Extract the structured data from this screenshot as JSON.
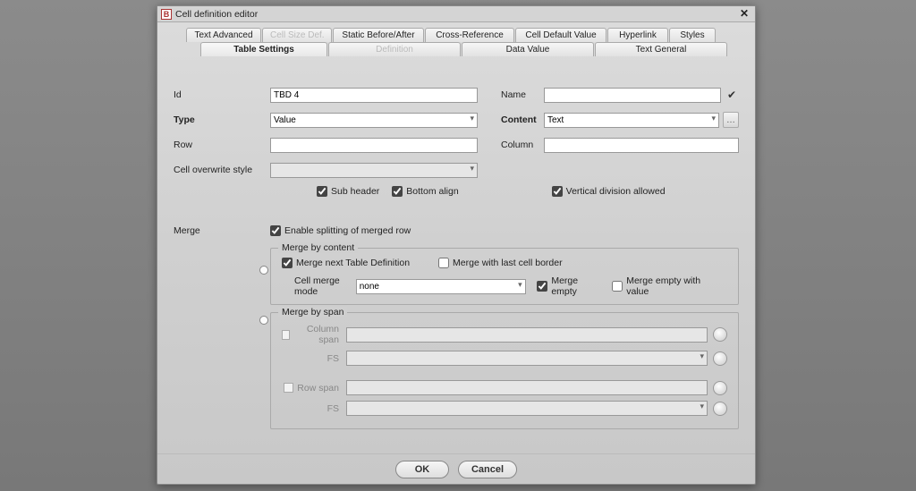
{
  "window": {
    "title": "Cell definition editor",
    "app_icon_letter": "B"
  },
  "tabs_row1": [
    {
      "label": "Text Advanced",
      "state": "normal"
    },
    {
      "label": "Cell Size Def.",
      "state": "disabled"
    },
    {
      "label": "Static Before/After",
      "state": "normal"
    },
    {
      "label": "Cross-Reference",
      "state": "normal"
    },
    {
      "label": "Cell Default Value",
      "state": "normal"
    },
    {
      "label": "Hyperlink",
      "state": "normal"
    },
    {
      "label": "Styles",
      "state": "normal"
    }
  ],
  "tabs_row2": [
    {
      "label": "Table Settings",
      "state": "active"
    },
    {
      "label": "Definition",
      "state": "disabled"
    },
    {
      "label": "Data Value",
      "state": "normal"
    },
    {
      "label": "Text General",
      "state": "normal"
    }
  ],
  "form": {
    "id_label": "Id",
    "id_value": "TBD 4",
    "name_label": "Name",
    "name_value": "",
    "type_label": "Type",
    "type_value": "Value",
    "content_label": "Content",
    "content_value": "Text",
    "row_label": "Row",
    "row_value": "",
    "column_label": "Column",
    "column_value": "",
    "overwrite_label": "Cell overwrite style",
    "overwrite_value": "",
    "subheader_label": "Sub header",
    "bottom_align_label": "Bottom align",
    "vertical_div_label": "Vertical division allowed"
  },
  "merge": {
    "section_label": "Merge",
    "enable_split_label": "Enable splitting of merged row",
    "by_content_legend": "Merge by content",
    "merge_next_label": "Merge next Table Definition",
    "merge_last_border_label": "Merge with last cell border",
    "cell_merge_mode_label": "Cell merge mode",
    "cell_merge_mode_value": "none",
    "merge_empty_label": "Merge empty",
    "merge_empty_value_label": "Merge empty with value",
    "by_span_legend": "Merge by span",
    "column_span_label": "Column span",
    "row_span_label": "Row span",
    "fs_label": "FS"
  },
  "footer": {
    "ok": "OK",
    "cancel": "Cancel"
  }
}
